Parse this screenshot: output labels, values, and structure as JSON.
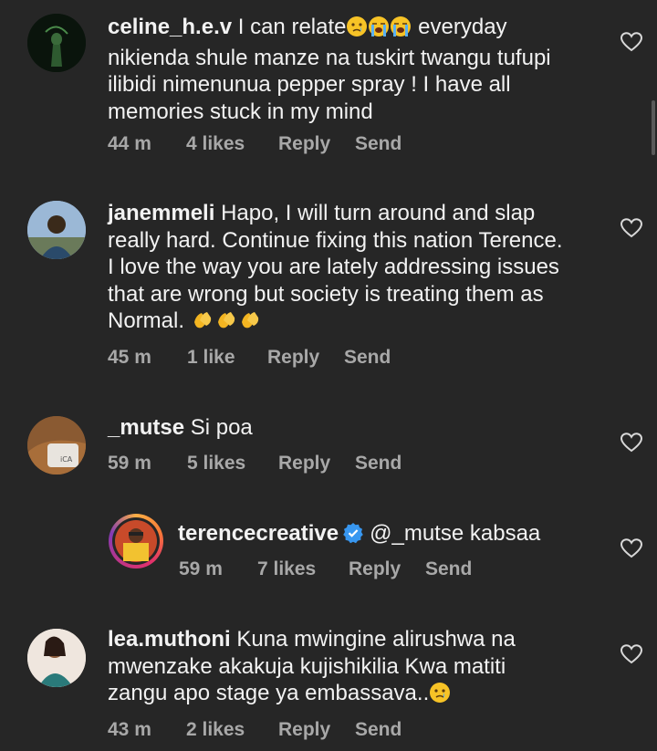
{
  "comments": [
    {
      "username": "celine_h.e.v",
      "text_lines": [
        "I can relate",
        "nikienda shule manze na tuskirt twangu tufupi",
        "ilibidi nimenunua pepper spray ! I have all",
        "memories stuck in my mind"
      ],
      "text_after_emoji": " everyday",
      "emoji": [
        "crying-face",
        "loudly-crying-face",
        "loudly-crying-face"
      ],
      "time": "44 m",
      "likes": "4 likes",
      "reply": "Reply",
      "send": "Send"
    },
    {
      "username": "janemmeli",
      "text_lines": [
        "Hapo, I will turn around and slap",
        "really hard. Continue fixing this nation Terence.",
        "I love the way you are lately addressing issues",
        "that are wrong but society is treating them as",
        "Normal."
      ],
      "emoji": [
        "clapping-hands",
        "clapping-hands",
        "clapping-hands"
      ],
      "time": "45 m",
      "likes": "1 like",
      "reply": "Reply",
      "send": "Send"
    },
    {
      "username": "_mutse",
      "text_lines": [
        "Si poa"
      ],
      "time": "59 m",
      "likes": "5 likes",
      "reply": "Reply",
      "send": "Send"
    },
    {
      "username": "terencecreative",
      "verified": true,
      "mention": "@_mutse",
      "text_lines": [
        " kabsaa"
      ],
      "time": "59 m",
      "likes": "7 likes",
      "reply": "Reply",
      "send": "Send"
    },
    {
      "username": "lea.muthoni",
      "text_lines": [
        "Kuna mwingine alirushwa na",
        "mwenzake akakuja kujishikilia Kwa matiti",
        "zangu apo stage ya embassava.."
      ],
      "emoji": [
        "crying-face"
      ],
      "time": "43 m",
      "likes": "2 likes",
      "reply": "Reply",
      "send": "Send"
    }
  ],
  "colors": {
    "background": "#262626",
    "text": "#f2f2f2",
    "meta": "#a8a8a8",
    "verified": "#3897f0"
  }
}
